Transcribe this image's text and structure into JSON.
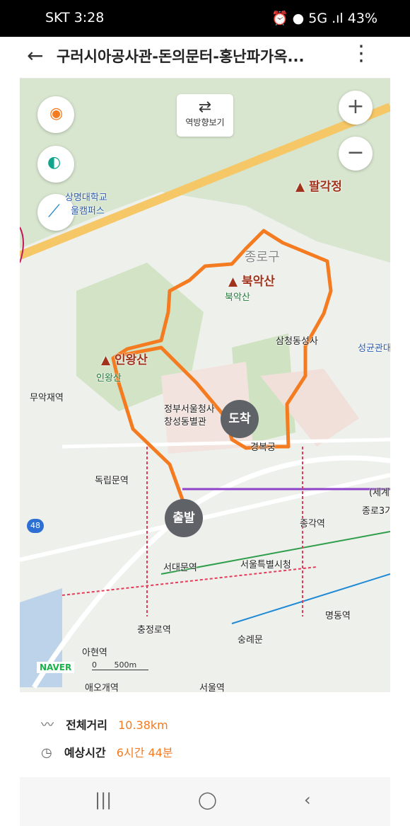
{
  "status": {
    "carrier_time": "SKT 3:28",
    "battery": "43%",
    "network": "5G"
  },
  "header": {
    "title": "구러시아공사관-돈의문터-홍난파가옥..."
  },
  "map": {
    "reverse_label": "역방향보기",
    "pins": {
      "start": "출발",
      "end": "도착"
    },
    "mountains": [
      {
        "name": "팔각정"
      },
      {
        "name": "북악산",
        "sub": "북악산"
      },
      {
        "name": "인왕산",
        "sub": "인왕산"
      }
    ],
    "labels": [
      "상명대학교",
      "울캠퍼스",
      "종로구",
      "삼청동성사",
      "성균관대",
      "무악재역",
      "정부서울청사",
      "창성동별관",
      "경복궁",
      "독립문역",
      "(세계",
      "종로3가",
      "종각역",
      "서대문역",
      "서울특별시청",
      "명동역",
      "충정로역",
      "숭례문",
      "아현역",
      "애오개역",
      "서울역"
    ],
    "road_shield": "48",
    "scale": "500m",
    "brand": "NAVER"
  },
  "summary": {
    "distance_label": "전체거리",
    "distance_value": "10.38km",
    "time_label": "예상시간",
    "time_value": "6시간 44분"
  },
  "colors": {
    "route": "#f47b20",
    "accent": "#f47b20",
    "mountain": "#1f9a7a"
  }
}
